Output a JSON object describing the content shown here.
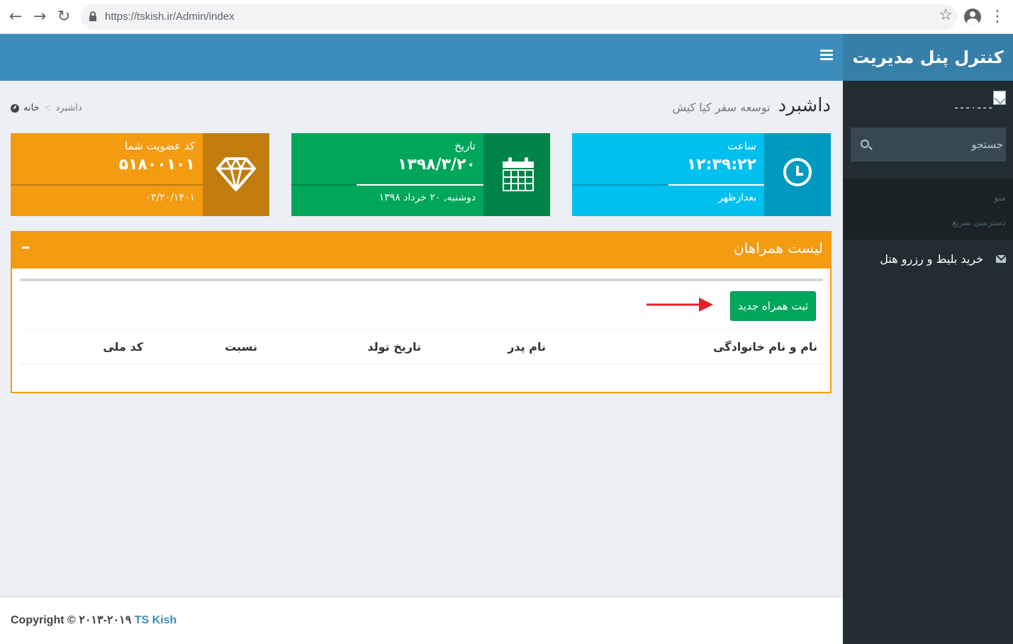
{
  "browser": {
    "url": "https://tskish.ir/Admin/index",
    "back": "←",
    "forward": "→",
    "reload": "↻",
    "star": "☆",
    "menu": "⋮"
  },
  "header": {
    "logo": "کنترل پنل مدیریت"
  },
  "sidebar": {
    "user_name": "ـ ـ ـ . ـ ـ ـ",
    "search_placeholder": "جستجو",
    "menu_header": "منو",
    "quick_access": "دسترسی سریع",
    "items": [
      {
        "label": "خرید بلیط و رزرو هتل",
        "icon": "envelope-icon"
      }
    ]
  },
  "content": {
    "title": "داشبرد",
    "subtitle": "توسعه سفر کیا کیش",
    "breadcrumb": {
      "home": "خانه",
      "current": "داشبرد",
      "separator": ">"
    }
  },
  "info_boxes": [
    {
      "text": "ساعت",
      "number": "۱۲:۳۹:۲۲",
      "desc": "بعدازظهر",
      "icon": "clock-icon",
      "bg": "#00c0ef",
      "progress": 0.5
    },
    {
      "text": "تاریخ",
      "number": "۱۳۹۸/۳/۲۰",
      "desc": "دوشنبه, ۲۰ خرداد ۱۳۹۸",
      "icon": "calendar-icon",
      "bg": "#00a65a",
      "progress": 0.66
    },
    {
      "text": "کد عضویت شما",
      "number": "۵۱۸۰۰۱۰۱",
      "desc": "۰۳/۲۰/۱۴۰۱",
      "icon": "diamond-icon",
      "bg": "#f39c12",
      "progress": 0
    }
  ],
  "companions_box": {
    "title": "لیست همراهان",
    "add_button": "ثبت همراه جدید",
    "columns": [
      "نام و نام خانوادگی",
      "نام پدر",
      "تاریخ تولد",
      "نسبت",
      "کد ملی"
    ]
  },
  "footer": {
    "copyright": "Copyright © ۲۰۱۳-۲۰۱۹",
    "brand": "TS Kish"
  },
  "colors": {
    "header": "#3c8dbc",
    "sidebar": "#222d32",
    "warning": "#f39c12",
    "success": "#00a65a",
    "info": "#00c0ef"
  }
}
